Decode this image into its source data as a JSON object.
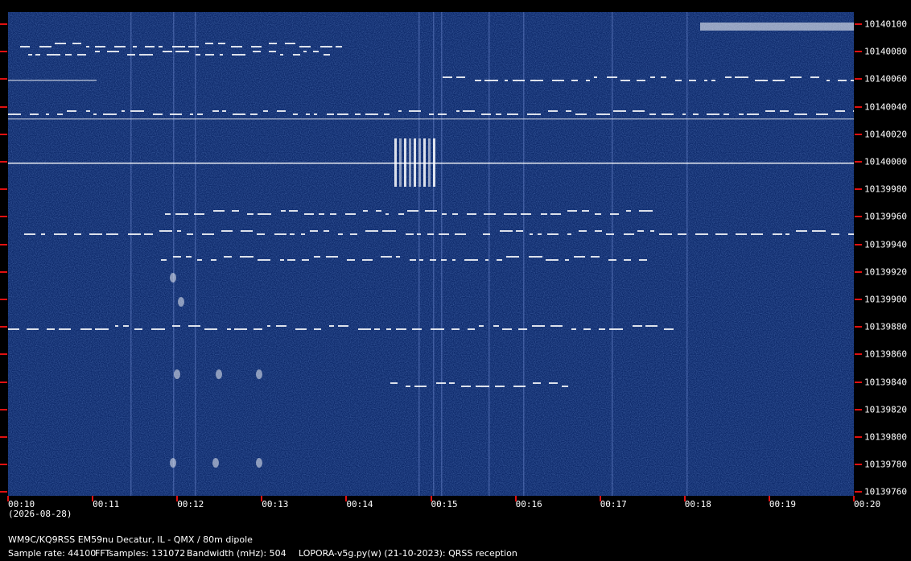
{
  "colors": {
    "background": "#000000",
    "plot_bg": "#0e2a6b",
    "signal": "#ffffff",
    "tick": "#e01010"
  },
  "y_axis": {
    "labels": [
      "10140100",
      "10140080",
      "10140060",
      "10140040",
      "10140020",
      "10140000",
      "10139980",
      "10139960",
      "10139940",
      "10139920",
      "10139900",
      "10139880",
      "10139860",
      "10139840",
      "10139820",
      "10139800",
      "10139780",
      "10139760"
    ]
  },
  "x_axis": {
    "labels": [
      "00:10",
      "00:11",
      "00:12",
      "00:13",
      "00:14",
      "00:15",
      "00:16",
      "00:17",
      "00:18",
      "00:19",
      "00:20"
    ],
    "date": "(2026-08-28)"
  },
  "info": {
    "station": "WM9C/KQ9RSS EM59nu Decatur, IL - QMX / 80m dipole",
    "sample_rate": "Sample rate: 44100",
    "fft_samples": "FFTsamples: 131072",
    "bandwidth": "Bandwidth (mHz): 504",
    "software": "LOPORA-v5g.py(w) (21-10-2023): QRSS reception"
  }
}
